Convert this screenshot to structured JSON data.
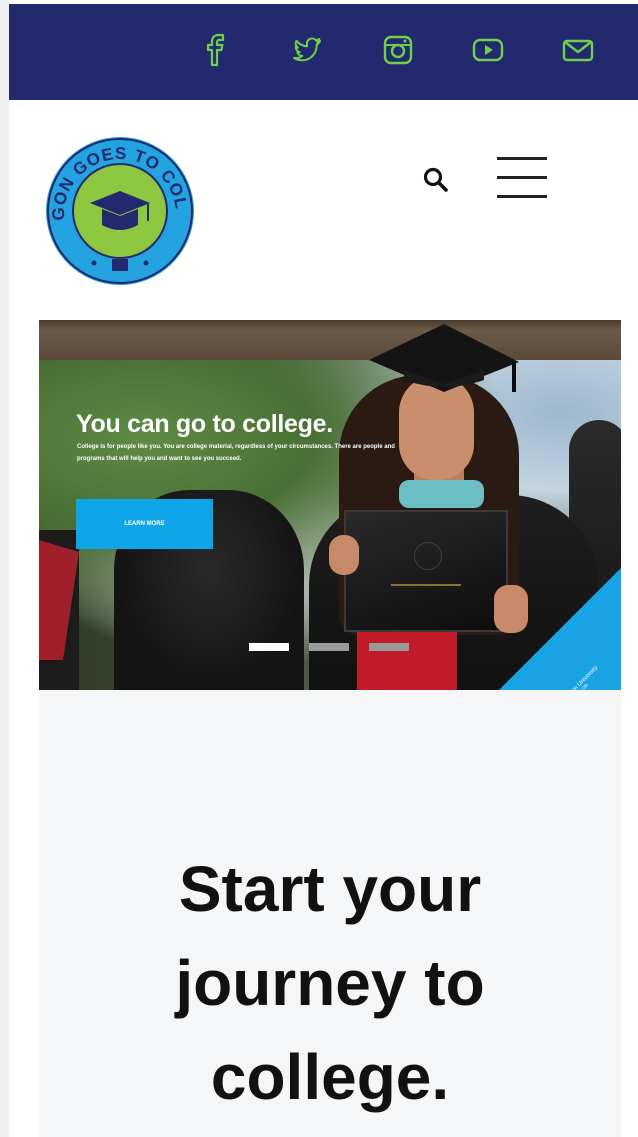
{
  "colors": {
    "topbar_bg": "#23296e",
    "social_icon": "#6fcf4a",
    "accent_blue": "#0ea5e9",
    "logo_ring": "#23a3e0",
    "logo_inner": "#8dc63f",
    "logo_navy": "#23296e"
  },
  "social": [
    {
      "name": "facebook-icon"
    },
    {
      "name": "twitter-icon"
    },
    {
      "name": "instagram-icon"
    },
    {
      "name": "youtube-icon"
    },
    {
      "name": "email-icon"
    }
  ],
  "logo": {
    "text": "OREGON GOES TO COLLEGE"
  },
  "header": {
    "search_icon": "search-icon",
    "menu_icon": "hamburger-menu-icon"
  },
  "hero": {
    "title": "You can go to college.",
    "subtitle": "College is for people like you. You are college material, regardless of your circumstances. There are people and programs that will help you and want to see you succeed.",
    "cta_label": "LEARN MORE",
    "badge_text": "Western Oregon University",
    "badge_subtext": "Monmouth, OR",
    "slides": {
      "count": 3,
      "active": 1
    }
  },
  "main": {
    "heading": "Start your\njourney to\ncollege."
  }
}
